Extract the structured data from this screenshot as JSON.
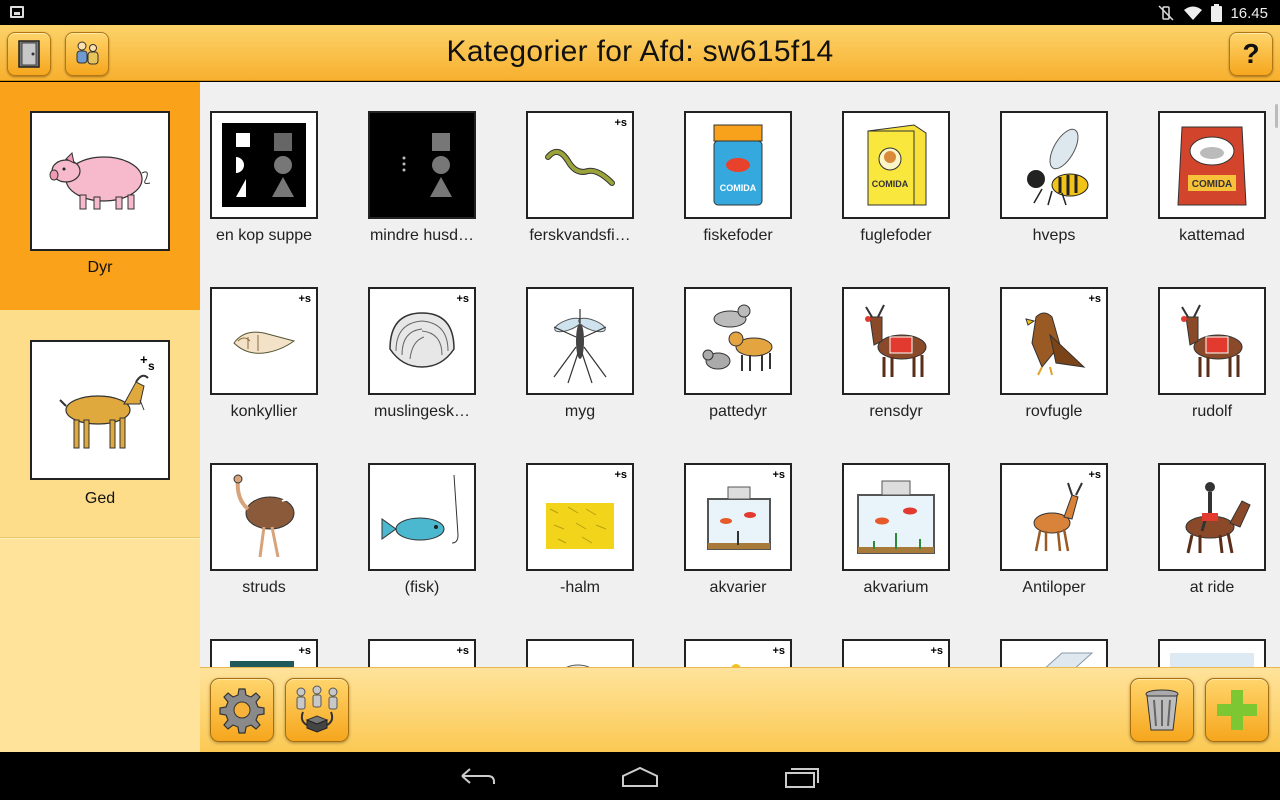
{
  "status_bar": {
    "time": "16.45"
  },
  "header": {
    "title": "Kategorier for Afd: sw615f14",
    "help_label": "?"
  },
  "sidebar": {
    "categories": [
      {
        "label": "Dyr",
        "selected": true
      },
      {
        "label": "Ged",
        "selected": false
      }
    ]
  },
  "grid": {
    "plus_badge": "+s",
    "items": [
      {
        "label": "en kop suppe",
        "icon": "shapes-white-icon"
      },
      {
        "label": "mindre husd…",
        "icon": "shapes-gray-icon"
      },
      {
        "label": "ferskvandsfi…",
        "icon": "eel-icon"
      },
      {
        "label": "fiskefoder",
        "icon": "fish-food-can-icon"
      },
      {
        "label": "fuglefoder",
        "icon": "bird-food-box-icon"
      },
      {
        "label": "hveps",
        "icon": "wasp-icon"
      },
      {
        "label": "kattemad",
        "icon": "cat-food-bag-icon"
      },
      {
        "label": "konkyllier",
        "icon": "conch-shell-icon"
      },
      {
        "label": "muslingesk…",
        "icon": "clam-shell-icon"
      },
      {
        "label": "myg",
        "icon": "mosquito-icon"
      },
      {
        "label": "pattedyr",
        "icon": "mammals-icon"
      },
      {
        "label": "rensdyr",
        "icon": "reindeer-icon"
      },
      {
        "label": "rovfugle",
        "icon": "eagle-icon"
      },
      {
        "label": "rudolf",
        "icon": "rudolph-icon"
      },
      {
        "label": "struds",
        "icon": "ostrich-icon"
      },
      {
        "label": "(fisk)",
        "icon": "fish-on-hook-icon"
      },
      {
        "label": "-halm",
        "icon": "hay-bale-icon"
      },
      {
        "label": "akvarier",
        "icon": "aquarium-icon"
      },
      {
        "label": "akvarium",
        "icon": "aquarium-icon"
      },
      {
        "label": "Antiloper",
        "icon": "antelope-icon"
      },
      {
        "label": "at ride",
        "icon": "horse-rider-icon"
      }
    ]
  },
  "colors": {
    "header": "#f7b02f",
    "sidebar_selected": "#f9a21a",
    "sidebar_item": "#fedd8a",
    "grid_background": "#f0f0f0",
    "add_green": "#7dc832"
  }
}
